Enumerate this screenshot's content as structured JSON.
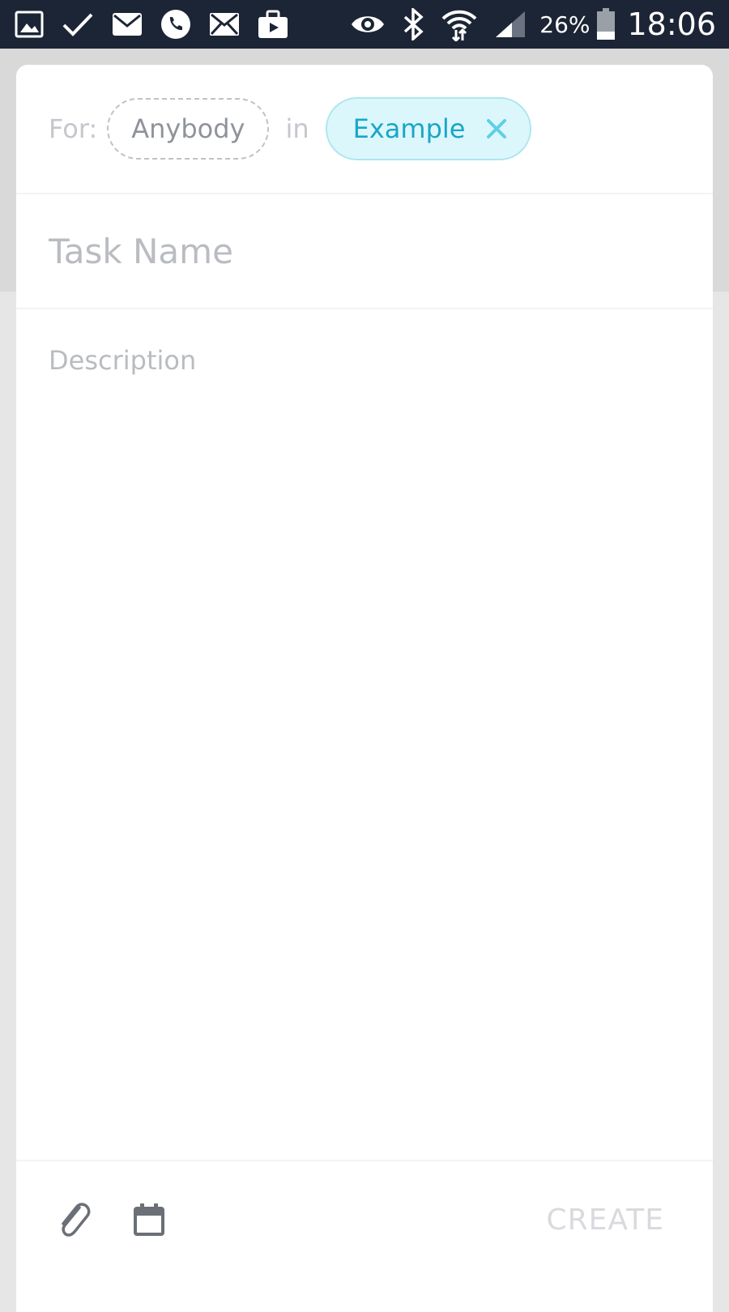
{
  "status_bar": {
    "battery_percent": "26%",
    "time": "18:06",
    "icons": [
      "gallery-icon",
      "check-icon",
      "email-icon",
      "phone-icon",
      "mail-icon",
      "briefcase-icon",
      "eye-icon",
      "bluetooth-icon",
      "wifi-icon",
      "signal-icon",
      "battery-icon"
    ]
  },
  "task_form": {
    "for_label": "For:",
    "assignee": "Anybody",
    "in_label": "in",
    "project": "Example",
    "task_name_placeholder": "Task Name",
    "task_name_value": "",
    "description_placeholder": "Description",
    "description_value": ""
  },
  "toolbar": {
    "attach_icon": "paperclip-icon",
    "due_date_icon": "calendar-icon",
    "create_label": "CREATE"
  },
  "colors": {
    "status_bar_bg": "#1c2535",
    "project_chip_bg": "#dcf7fc",
    "project_chip_text": "#1aa6c8",
    "placeholder_text": "#b9bcc1",
    "create_disabled": "#d8dadd"
  }
}
